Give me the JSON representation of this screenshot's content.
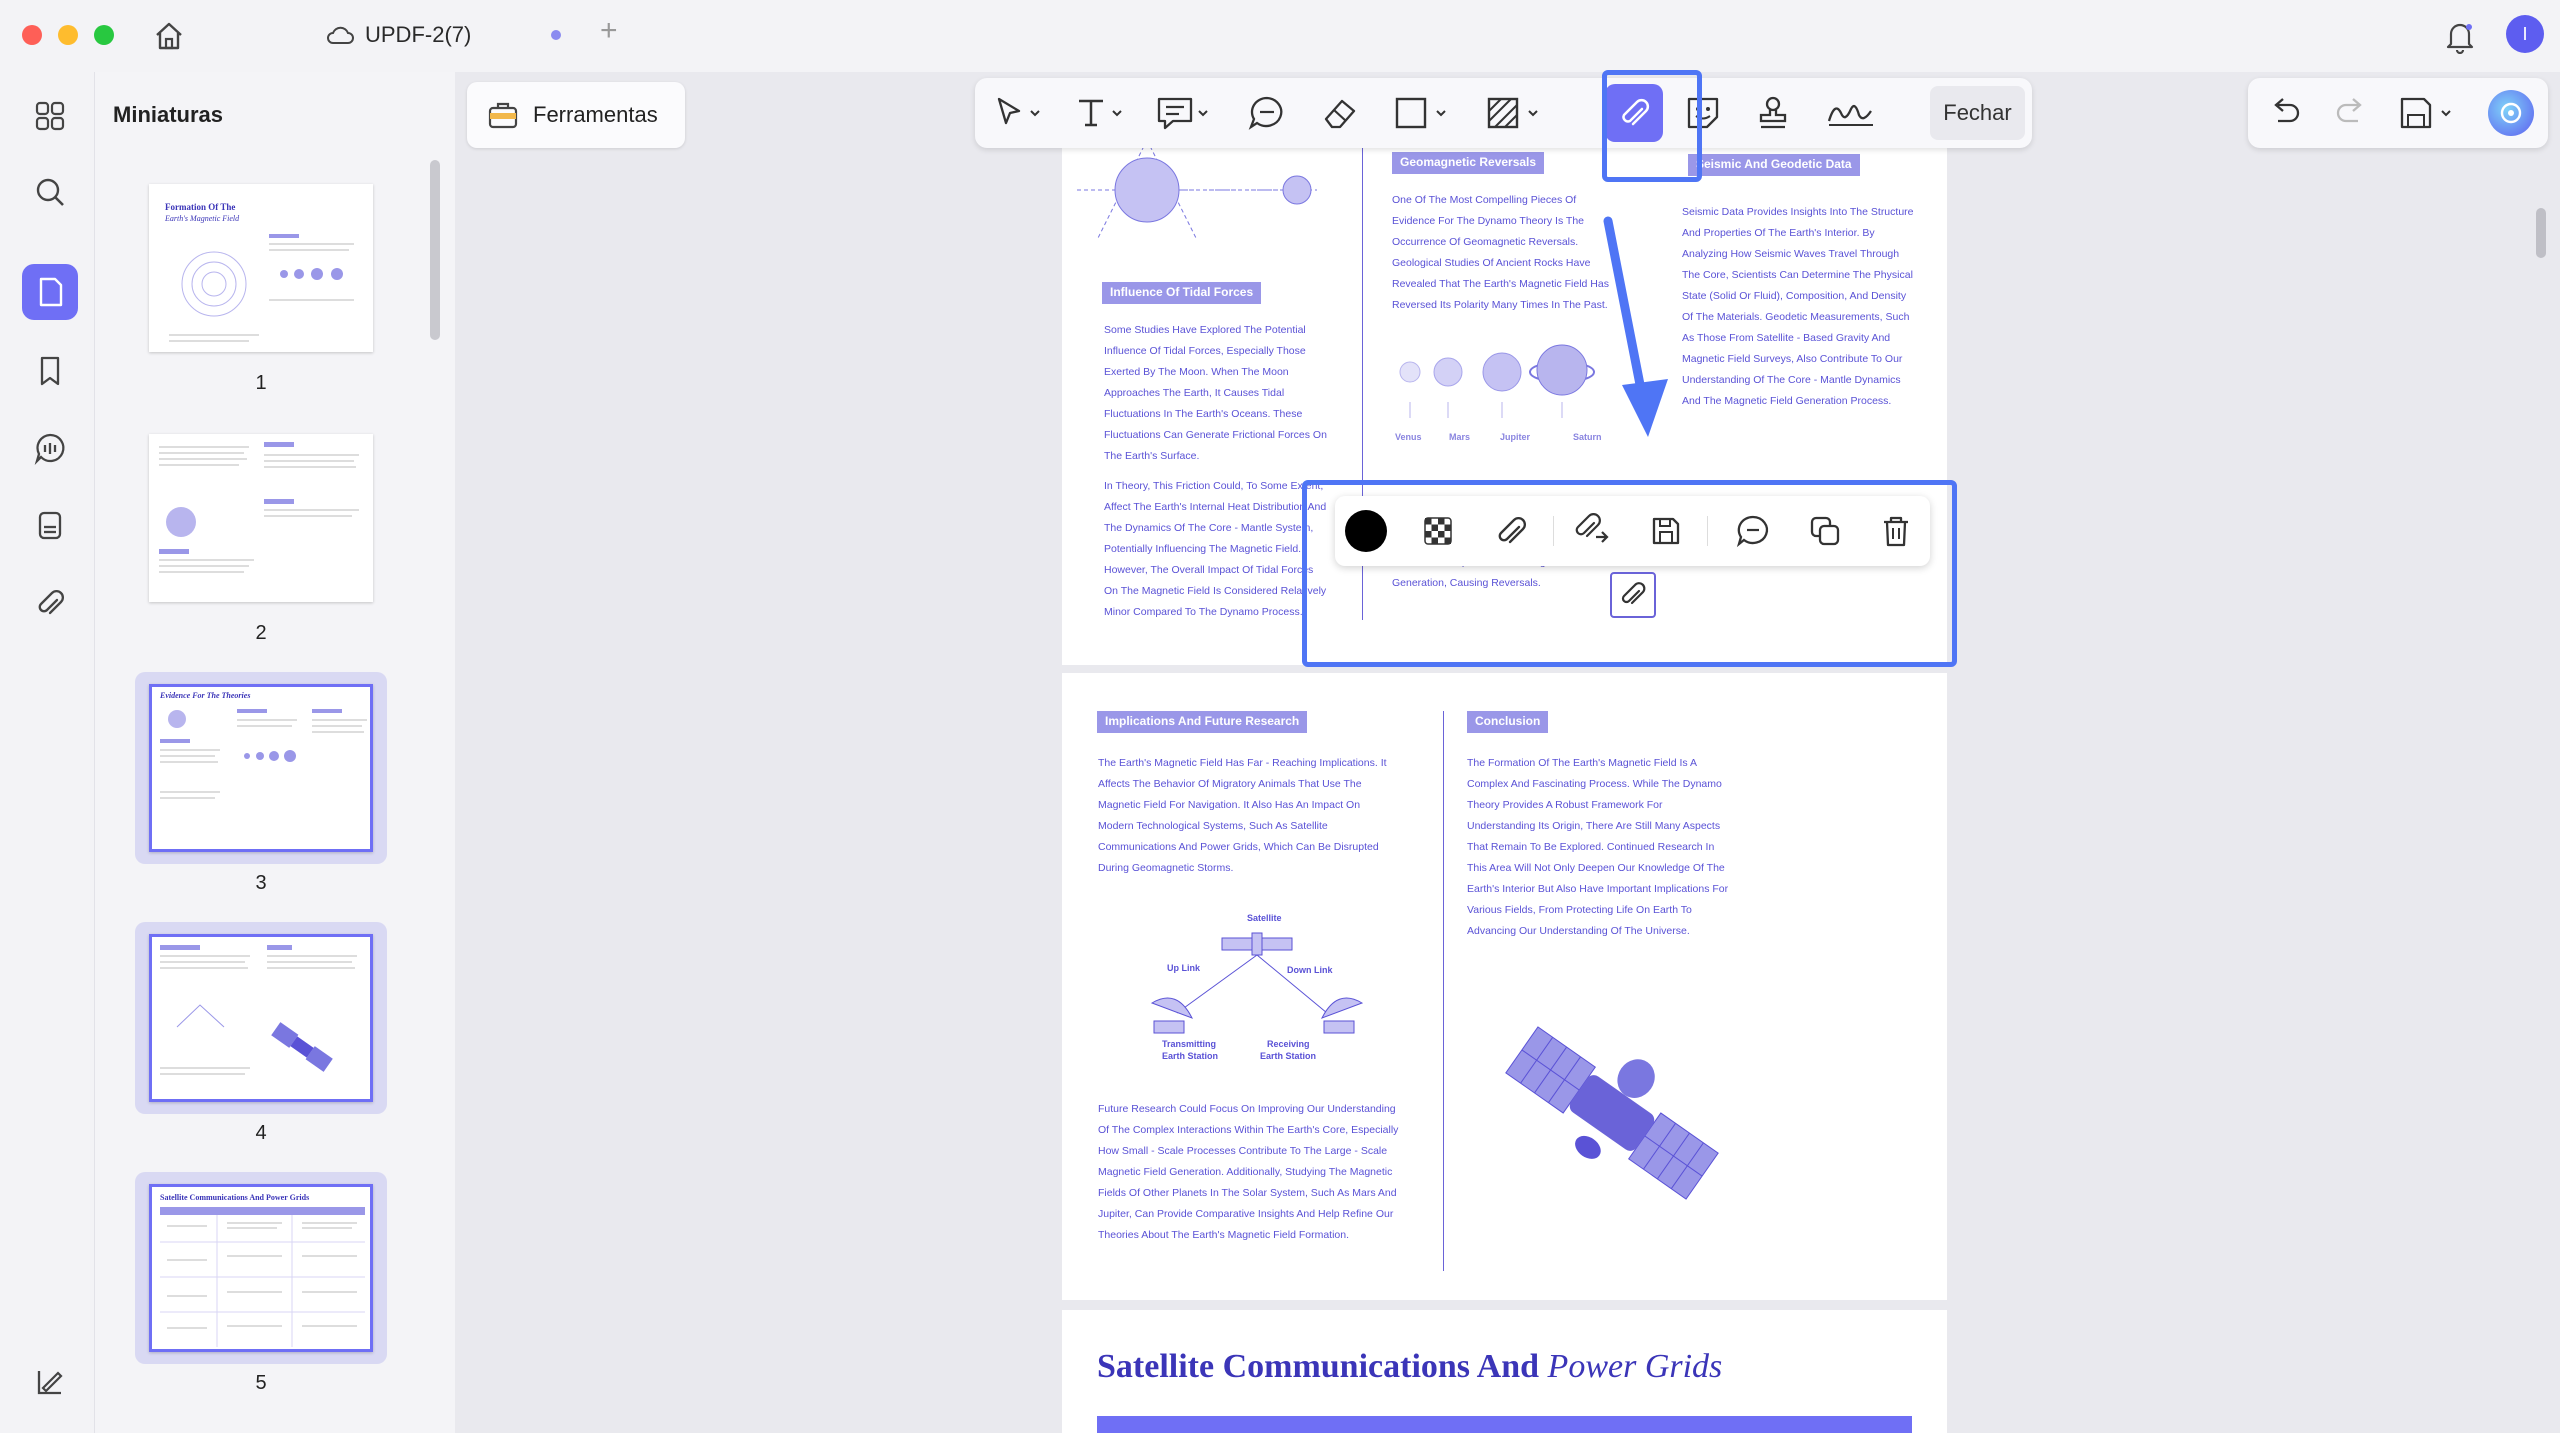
{
  "window": {
    "tab_title": "UPDF-2(7)",
    "new_tab": "+"
  },
  "thumbnails": {
    "title": "Miniaturas",
    "pages": [
      {
        "num": "1",
        "heading_a": "Formation Of The",
        "heading_b": "Earth's Magnetic Field"
      },
      {
        "num": "2"
      },
      {
        "num": "3",
        "heading": "Evidence For The Theories"
      },
      {
        "num": "4"
      },
      {
        "num": "5",
        "heading": "Satellite Communications And Power Grids"
      }
    ]
  },
  "toolbar": {
    "tools_label": "Ferramentas",
    "close_label": "Fechar"
  },
  "doc": {
    "page1": {
      "tidal_head": "Influence Of Tidal Forces",
      "tidal_text": "Some Studies Have Explored The Potential Influence Of Tidal Forces, Especially Those Exerted By The Moon. When The Moon Approaches The Earth, It Causes Tidal Fluctuations In The Earth's Oceans. These Fluctuations Can Generate Frictional Forces On The Earth's Surface.",
      "tidal_text2": "In Theory, This Friction Could, To Some Extent, Affect The Earth's Internal Heat Distribution And The Dynamics Of The Core - Mantle System, Potentially Influencing The Magnetic Field. However, The Overall Impact Of Tidal Forces On The Magnetic Field Is Considered Relatively Minor Compared To The Dynamo Process.",
      "geo_head": "Geomagnetic Reversals",
      "geo_text": "One Of The Most Compelling Pieces Of Evidence For The Dynamo Theory Is The Occurrence Of Geomagnetic Reversals. Geological Studies Of Ancient Rocks Have Revealed That The Earth's Magnetic Field Has Reversed Its Polarity Many Times In The Past.",
      "geo_text2": "Leads To Disruptions In The Magnetic Field Generation, Causing Reversals.",
      "seis_head": "Seismic And Geodetic Data",
      "seis_text": "Seismic Data Provides Insights Into The Structure And Properties Of The Earth's Interior. By Analyzing How Seismic Waves Travel Through The Core, Scientists Can Determine The Physical State (Solid Or Fluid), Composition, And Density Of The Materials. Geodetic Measurements, Such As Those From Satellite - Based Gravity And Magnetic Field Surveys, Also Contribute To Our Understanding Of The Core - Mantle Dynamics And The Magnetic Field Generation Process.",
      "planets": [
        "Venus",
        "Mars",
        "Jupiter",
        "Saturn"
      ]
    },
    "page2": {
      "impl_head": "Implications And Future Research",
      "impl_text": "The Earth's Magnetic Field Has Far - Reaching Implications. It Affects The Behavior Of Migratory Animals That Use The Magnetic Field For Navigation. It Also Has An Impact On Modern Technological Systems, Such As Satellite Communications And Power Grids, Which Can Be Disrupted During Geomagnetic Storms.",
      "concl_head": "Conclusion",
      "concl_text": "The Formation Of The Earth's Magnetic Field Is A Complex And Fascinating Process. While The Dynamo Theory Provides A Robust Framework For Understanding Its Origin, There Are Still Many Aspects That Remain To Be Explored. Continued Research In This Area Will Not Only Deepen Our Knowledge Of The Earth's Interior But Also Have Important Implications For Various Fields, From Protecting Life On Earth To Advancing Our Understanding Of The Universe.",
      "sat_label": "Satellite",
      "uplink": "Up Link",
      "downlink": "Down Link",
      "tx_a": "Transmitting",
      "tx_b": "Earth Station",
      "rx_a": "Receiving",
      "rx_b": "Earth Station",
      "future_text": "Future Research Could Focus On Improving Our Understanding Of The Complex Interactions Within The Earth's Core, Especially How Small - Scale Processes Contribute To The Large - Scale Magnetic Field Generation. Additionally, Studying The Magnetic Fields Of Other Planets In The Solar System, Such As Mars And Jupiter, Can Provide Comparative Insights And Help Refine Our Theories About The Earth's Magnetic Field Formation."
    },
    "page3": {
      "title_a": "Satellite Communications And ",
      "title_b": "Power Grids"
    }
  },
  "colors": {
    "accent": "#6f6ff5",
    "highlight": "#4f75f5",
    "doc_text": "#5a52d6"
  }
}
